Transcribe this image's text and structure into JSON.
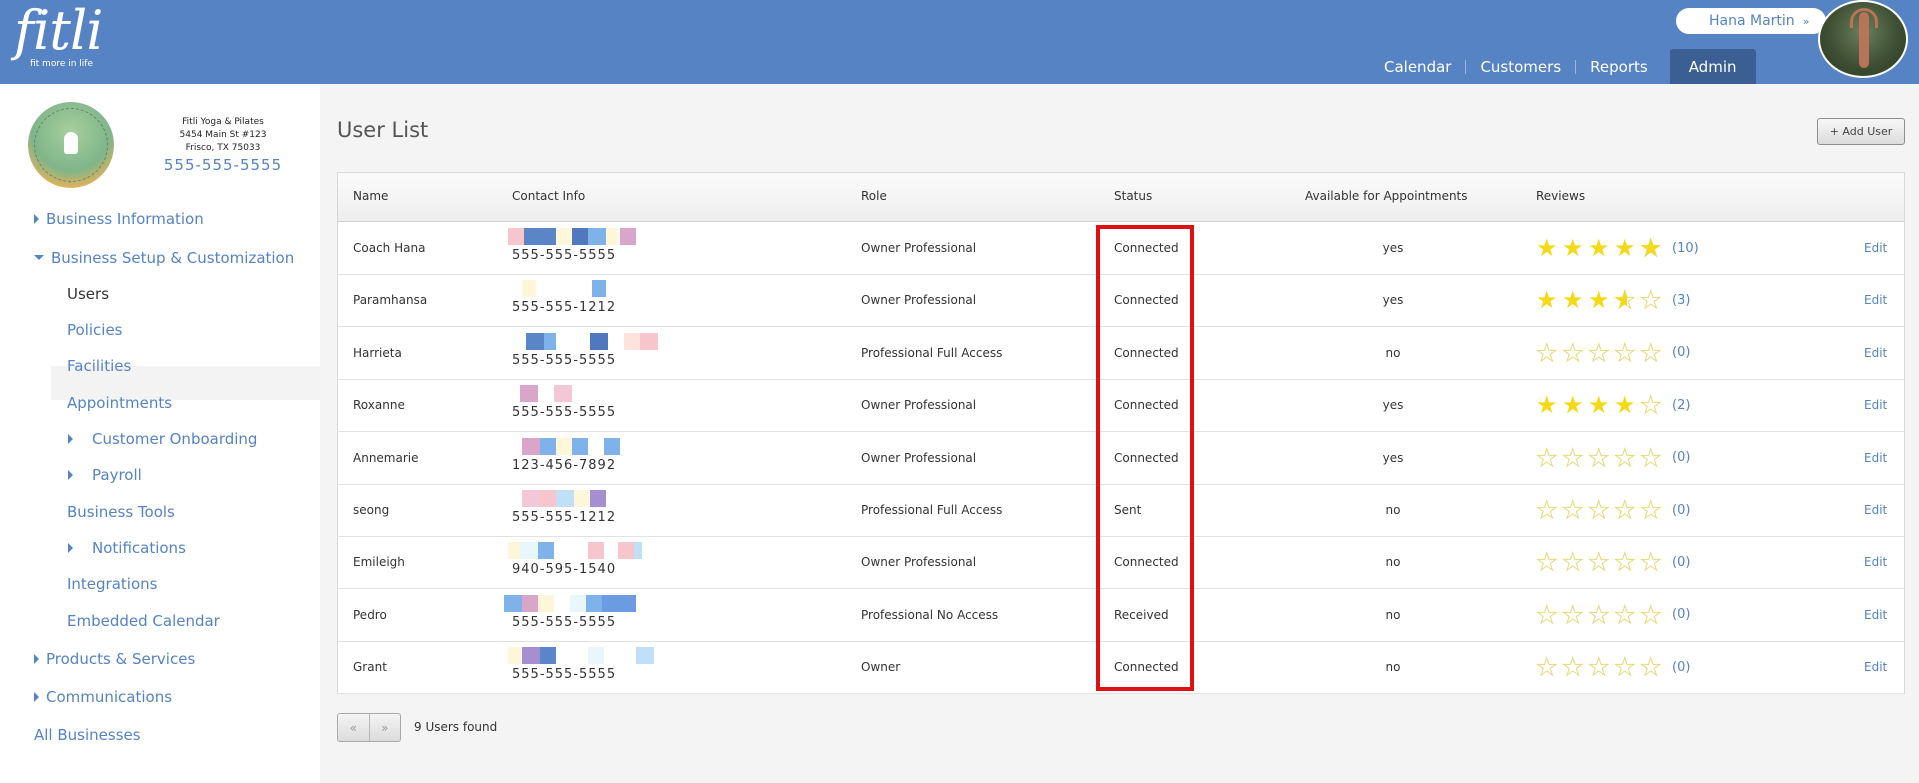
{
  "header": {
    "logo_word": "fitli",
    "logo_tagline": "fit more in life",
    "user_name": "Hana Martin",
    "nav": [
      "Calendar",
      "Customers",
      "Reports",
      "Admin"
    ],
    "active_nav": "Admin"
  },
  "business": {
    "name": "Fitli Yoga & Pilates",
    "address1": "5454 Main St #123",
    "address2": "Frisco, TX 75033",
    "phone": "555-555-5555"
  },
  "sidebar": {
    "items": [
      {
        "label": "Business Information",
        "caret": "right",
        "indent": 0
      },
      {
        "label": "Business Setup & Customization",
        "caret": "down",
        "indent": 0
      },
      {
        "label": "Users",
        "caret": "none",
        "indent": 1,
        "active": true
      },
      {
        "label": "Policies",
        "caret": "none",
        "indent": 1
      },
      {
        "label": "Facilities",
        "caret": "none",
        "indent": 1
      },
      {
        "label": "Appointments",
        "caret": "none",
        "indent": 1
      },
      {
        "label": "Customer Onboarding",
        "caret": "right",
        "indent": 2
      },
      {
        "label": "Payroll",
        "caret": "right",
        "indent": 2
      },
      {
        "label": "Business Tools",
        "caret": "none",
        "indent": 1
      },
      {
        "label": "Notifications",
        "caret": "right",
        "indent": 2
      },
      {
        "label": "Integrations",
        "caret": "none",
        "indent": 1
      },
      {
        "label": "Embedded Calendar",
        "caret": "none",
        "indent": 1
      },
      {
        "label": "Products & Services",
        "caret": "right",
        "indent": 0
      },
      {
        "label": "Communications",
        "caret": "right",
        "indent": 0
      },
      {
        "label": "All Businesses",
        "caret": "none",
        "indent": 0
      }
    ]
  },
  "main": {
    "title": "User List",
    "add_user_label": "+ Add User",
    "columns": [
      "Name",
      "Contact Info",
      "Role",
      "Status",
      "Available for Appointments",
      "Reviews"
    ],
    "edit_label": "Edit",
    "rows": [
      {
        "name": "Coach Hana",
        "phone": "555-555-5555",
        "role": "Owner Professional",
        "status": "Connected",
        "available": "yes",
        "rating": 4.7,
        "reviews": "(10)"
      },
      {
        "name": "Paramhansa",
        "phone": "555-555-1212",
        "role": "Owner Professional",
        "status": "Connected",
        "available": "yes",
        "rating": 3.5,
        "reviews": "(3)"
      },
      {
        "name": "Harrieta",
        "phone": "555-555-5555",
        "role": "Professional Full Access",
        "status": "Connected",
        "available": "no",
        "rating": 0,
        "reviews": "(0)"
      },
      {
        "name": "Roxanne",
        "phone": "555-555-5555",
        "role": "Owner Professional",
        "status": "Connected",
        "available": "yes",
        "rating": 4,
        "reviews": "(2)"
      },
      {
        "name": "Annemarie",
        "phone": "123-456-7892",
        "role": "Owner Professional",
        "status": "Connected",
        "available": "yes",
        "rating": 0,
        "reviews": "(0)"
      },
      {
        "name": "seong",
        "phone": "555-555-1212",
        "role": "Professional Full Access",
        "status": "Sent",
        "available": "no",
        "rating": 0,
        "reviews": "(0)"
      },
      {
        "name": "Emileigh",
        "phone": "940-595-1540",
        "role": "Owner Professional",
        "status": "Connected",
        "available": "no",
        "rating": 0,
        "reviews": "(0)"
      },
      {
        "name": "Pedro",
        "phone": "555-555-5555",
        "role": "Professional No Access",
        "status": "Received",
        "available": "no",
        "rating": 0,
        "reviews": "(0)"
      },
      {
        "name": "Grant",
        "phone": "555-555-5555",
        "role": "Owner",
        "status": "Connected",
        "available": "no",
        "rating": 0,
        "reviews": "(0)"
      }
    ],
    "pager_prev": "«",
    "pager_next": "»",
    "found_label": "9 Users found"
  },
  "colors": {
    "brand": "#5583c4",
    "nav_active": "#3b5f93",
    "highlight": "#e01010",
    "star": "#f5d915"
  }
}
